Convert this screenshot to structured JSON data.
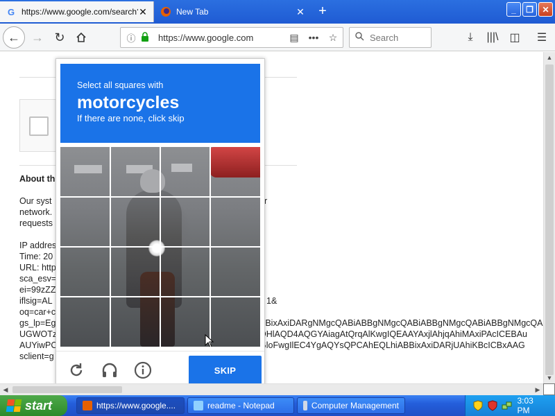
{
  "browser": {
    "tabs": [
      {
        "title": "https://www.google.com/search?c",
        "favicon": "google-g-icon"
      },
      {
        "title": "New Tab",
        "favicon": "firefox-icon"
      }
    ],
    "new_tab_symbol": "+",
    "window_buttons": {
      "minimize": "_",
      "maximize": "❐",
      "close": "✕"
    },
    "url": "https://www.google.com",
    "search_placeholder": "Search"
  },
  "page": {
    "about_heading": "About th",
    "paragraph_lines": [
      "Our syst",
      "network.",
      "requests"
    ],
    "paragraph_tail": "r",
    "details_lines": [
      "IP addres",
      "Time: 20",
      "URL: http",
      "sca_esv=",
      "ei=99zZZ",
      "iflsig=AL",
      "oq=car+c",
      "gs_lp=Eg",
      "UGWOTz",
      "AUYiwPC",
      "sclient=g"
    ],
    "details_right": [
      {
        "line": "1&",
        "row": 5
      },
      {
        "line": "BBixAxiDARgNMgcQABiABBgNMgcQABiABBgNMgcQABiABBgNMgcQABiABBgNMg",
        "row": 7
      },
      {
        "line": "QHlAQD4AQGYAiagAtQrqAlKwgIQEAAYAxjlAhjqAhiMAxiPAcICEBAu",
        "row": 8
      },
      {
        "line": "GloFwgIlEC4YgAQYsQPCAhEQLhiABBixAxiDARjUAhiKBcICBxAAG",
        "row": 9
      }
    ]
  },
  "captcha": {
    "instruction": "Select all squares with",
    "target": "motorcycles",
    "hint": "If there are none, click skip",
    "grid_rows": 4,
    "grid_cols": 4,
    "skip_label": "SKIP",
    "footer_icons": [
      "reload-icon",
      "audio-challenge-icon",
      "info-icon"
    ]
  },
  "taskbar": {
    "start_label": "start",
    "tasks": [
      {
        "label": "https://www.google....",
        "icon": "firefox-icon",
        "active": true
      },
      {
        "label": "readme - Notepad",
        "icon": "notepad-icon",
        "active": false
      },
      {
        "label": "Computer Management",
        "icon": "computer-management-icon",
        "active": false
      }
    ],
    "clock": "3:03 PM"
  }
}
